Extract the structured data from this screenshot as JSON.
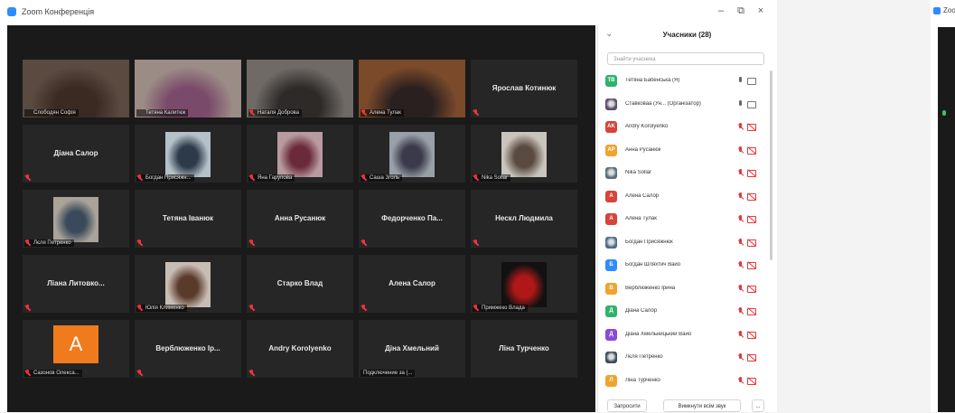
{
  "window": {
    "title": "Zoom Конференція",
    "minimize": "–",
    "maximize": "⧉",
    "close": "×"
  },
  "tiles": [
    {
      "name": "",
      "caption": "Слободян Софія",
      "kind": "video",
      "active": true,
      "muted": false,
      "bg": "#5a4a40",
      "hue": "#3a2a22"
    },
    {
      "name": "",
      "caption": "Тетяна Калитюк",
      "kind": "video",
      "muted": false,
      "bg": "#9c8c86",
      "hue": "#7a4a6a"
    },
    {
      "name": "",
      "caption": "Наталя Доброва",
      "kind": "video",
      "muted": true,
      "bg": "#6f6a66",
      "hue": "#2e2a28"
    },
    {
      "name": "",
      "caption": "Алена Тулак",
      "kind": "video",
      "muted": true,
      "bg": "#7a4a2a",
      "hue": "#2a2020"
    },
    {
      "name": "Ярослав Котинюк",
      "caption": "",
      "kind": "name",
      "muted": true
    },
    {
      "name": "Діана Салор",
      "caption": "",
      "kind": "name",
      "muted": true
    },
    {
      "name": "",
      "caption": "Богдан Присяжн...",
      "kind": "photo",
      "muted": true,
      "bg": "#b5c1c9",
      "hue": "#2c3a4a"
    },
    {
      "name": "",
      "caption": "Яна Гарупова",
      "kind": "photo",
      "muted": true,
      "bg": "#b89aa0",
      "hue": "#6a2a3a"
    },
    {
      "name": "",
      "caption": "Саша Зголь",
      "kind": "photo",
      "muted": true,
      "bg": "#9aa0a8",
      "hue": "#3a3a4a"
    },
    {
      "name": "",
      "caption": "Nika Sollar",
      "kind": "photo",
      "muted": true,
      "bg": "#c9c4bd",
      "hue": "#5a4a40"
    },
    {
      "name": "",
      "caption": "Лєля Петренко",
      "kind": "photo",
      "muted": true,
      "bg": "#a9a39a",
      "hue": "#3a4a5a"
    },
    {
      "name": "Тетяна Іванюк",
      "caption": "",
      "kind": "name",
      "muted": true
    },
    {
      "name": "Анна Русанюк",
      "caption": "",
      "kind": "name",
      "muted": true
    },
    {
      "name": "Федорченко Па...",
      "caption": "",
      "kind": "name",
      "muted": true
    },
    {
      "name": "Нескл Людмила",
      "caption": "",
      "kind": "name",
      "muted": true
    },
    {
      "name": "Ліана Литовко...",
      "caption": "",
      "kind": "name",
      "muted": true
    },
    {
      "name": "",
      "caption": "Юлія Клименко",
      "kind": "photo",
      "muted": true,
      "bg": "#c8bdb4",
      "hue": "#5a3a2a"
    },
    {
      "name": "Старко Влад",
      "caption": "",
      "kind": "name",
      "muted": true
    },
    {
      "name": "Алена Салор",
      "caption": "",
      "kind": "name",
      "muted": true
    },
    {
      "name": "",
      "caption": "Примжеко Влада",
      "kind": "photo",
      "muted": true,
      "bg": "#111",
      "hue": "#b01818"
    },
    {
      "name": "",
      "caption": "Сазонов Олекса...",
      "kind": "avatar",
      "avatar": "A",
      "muted": true
    },
    {
      "name": "Верблюженко Ір...",
      "caption": "",
      "kind": "name",
      "muted": true
    },
    {
      "name": "Andry Korolyenko",
      "caption": "",
      "kind": "name",
      "muted": true
    },
    {
      "name": "Діна Хмельний",
      "caption": "Подключение за (...",
      "kind": "name",
      "muted": false,
      "plain": true
    },
    {
      "name": "Ліна Турченко",
      "caption": "",
      "kind": "name",
      "muted": false,
      "nomic": true
    }
  ],
  "participants": {
    "title": "Учасники (28)",
    "collapse": "⌄",
    "search_placeholder": "Знайти учасника",
    "list": [
      {
        "initials": "ТВ",
        "name": "Тетяна Бабенська (Я)",
        "color": "#2fb36b",
        "mic": true,
        "cam": true
      },
      {
        "initials": "",
        "name": "Ставковаа (Ун... (Організатор)",
        "color": "#5a4a6a",
        "mic": true,
        "cam": true,
        "photo": true
      },
      {
        "initials": "AK",
        "name": "Andry Korolyenko",
        "color": "#d8433b",
        "mic": false,
        "cam": false
      },
      {
        "initials": "АР",
        "name": "Анна Русанюк",
        "color": "#f2a22d",
        "mic": false,
        "cam": false
      },
      {
        "initials": "",
        "name": "Nika Sollar",
        "color": "#5a6a7a",
        "mic": false,
        "cam": false,
        "photo": true
      },
      {
        "initials": "А",
        "name": "Алена Салор",
        "color": "#d8433b",
        "mic": false,
        "cam": false
      },
      {
        "initials": "А",
        "name": "Алена Тулак",
        "color": "#d8433b",
        "mic": false,
        "cam": false
      },
      {
        "initials": "",
        "name": "Богдан Присяжнюк",
        "color": "#4a6a8a",
        "mic": false,
        "cam": false,
        "photo": true
      },
      {
        "initials": "Б",
        "name": "Богдан Шляхтич Вайо",
        "color": "#2d8cff",
        "mic": false,
        "cam": false
      },
      {
        "initials": "В",
        "name": "Верблюженко Ірина",
        "color": "#f2a22d",
        "mic": false,
        "cam": false
      },
      {
        "initials": "Д",
        "name": "Діана Салор",
        "color": "#2fb36b",
        "mic": false,
        "cam": false
      },
      {
        "initials": "Д",
        "name": "Діана Хмельницький Вайо",
        "color": "#8a4ad8",
        "mic": false,
        "cam": false
      },
      {
        "initials": "",
        "name": "Лєля Петренко",
        "color": "#3a4a5a",
        "mic": false,
        "cam": false,
        "photo": true
      },
      {
        "initials": "Л",
        "name": "Ліна Турченко",
        "color": "#f2a22d",
        "mic": false,
        "cam": false
      }
    ],
    "invite_label": "Запросити",
    "mute_all_label": "Вимкнути всім звук",
    "more_label": "..."
  },
  "second_window": {
    "title": "Zoo"
  }
}
